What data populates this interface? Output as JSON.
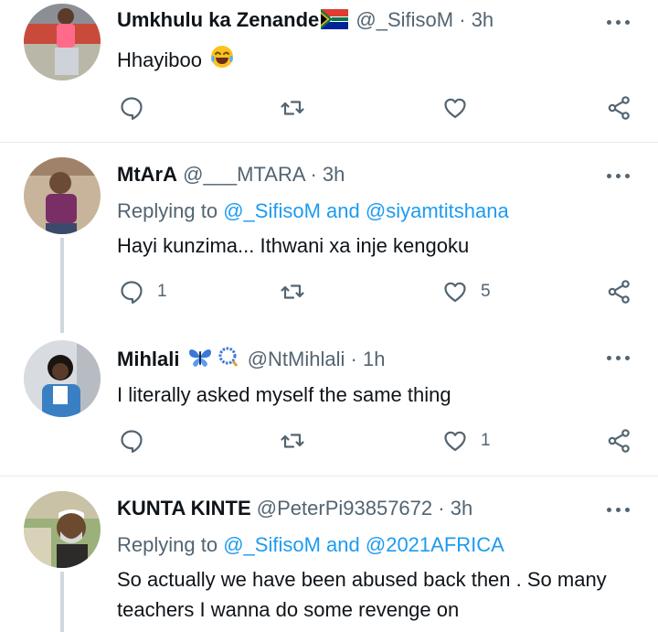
{
  "colors": {
    "link": "#1d9bf0",
    "secondary": "#536471",
    "divider": "#e6ecf0"
  },
  "tweets": [
    {
      "name": "Umkhulu ka Zenande",
      "name_emoji": "south-africa-flag",
      "handle": "@_SifisoM",
      "dot": "·",
      "time": "3h",
      "text": "Hhayiboo",
      "text_emoji": "tears-of-joy",
      "reply_count": "",
      "retweet_count": "",
      "like_count": ""
    },
    {
      "name": "MtArA",
      "handle": "@___MTARA",
      "dot": "·",
      "time": "3h",
      "replying_prefix": "Replying to",
      "replying_user1": "@_SifisoM",
      "replying_and": "and",
      "replying_user2": "@siyamtitshana",
      "text": "Hayi kunzima... Ithwani xa inje kengoku",
      "reply_count": "1",
      "retweet_count": "",
      "like_count": "5"
    },
    {
      "name": "Mihlali",
      "name_emoji": "butterfly, prayer-beads",
      "handle": "@NtMihlali",
      "dot": "·",
      "time": "1h",
      "text": "I literally asked myself the same thing",
      "reply_count": "",
      "retweet_count": "",
      "like_count": "1"
    },
    {
      "name": "KUNTA KINTE",
      "handle": "@PeterPi93857672",
      "dot": "·",
      "time": "3h",
      "replying_prefix": "Replying to",
      "replying_user1": "@_SifisoM",
      "replying_and": "and",
      "replying_user2": "@2021AFRICA",
      "text": "So actually we have been abused back then . So many teachers I wanna do some revenge on"
    }
  ]
}
